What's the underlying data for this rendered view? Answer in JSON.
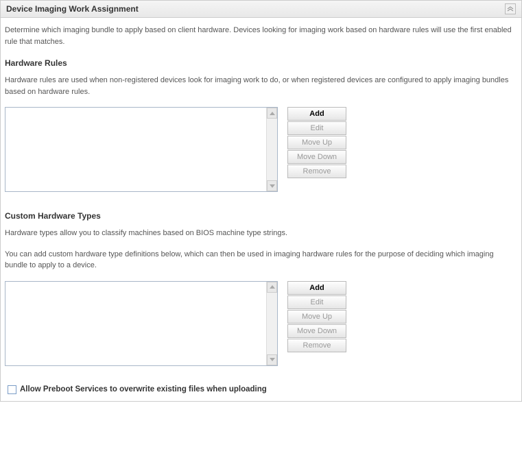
{
  "panel": {
    "title": "Device Imaging Work Assignment"
  },
  "intro": "Determine which imaging bundle to apply based on client hardware. Devices looking for imaging work based on hardware rules will use the first enabled rule that matches.",
  "hardwareRules": {
    "heading": "Hardware Rules",
    "desc": "Hardware rules are used when non-registered devices look for imaging work to do, or when registered devices are configured to apply imaging bundles based on hardware rules.",
    "buttons": {
      "add": "Add",
      "edit": "Edit",
      "moveUp": "Move Up",
      "moveDown": "Move Down",
      "remove": "Remove"
    }
  },
  "customTypes": {
    "heading": "Custom Hardware Types",
    "desc1": "Hardware types allow you to classify machines based on BIOS machine type strings.",
    "desc2": "You can add custom hardware type definitions below, which can then be used in imaging hardware rules for the purpose of deciding which imaging bundle to apply to a device.",
    "buttons": {
      "add": "Add",
      "edit": "Edit",
      "moveUp": "Move Up",
      "moveDown": "Move Down",
      "remove": "Remove"
    }
  },
  "checkbox": {
    "label": "Allow Preboot Services to overwrite existing files when uploading"
  }
}
